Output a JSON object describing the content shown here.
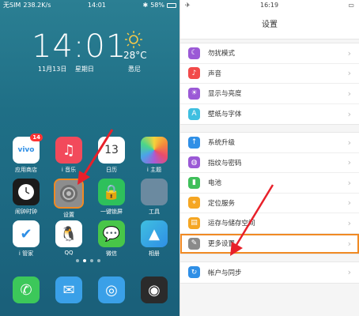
{
  "home": {
    "status": {
      "carrier": "无SIM",
      "speed": "238.2K/s",
      "time": "14:01",
      "battery": "58%"
    },
    "clock": "14:01",
    "date": "11月13日 星期日",
    "temperature": "28°C",
    "city": "悉尼",
    "apps": [
      {
        "label": "应用商店",
        "color": "#ffffff",
        "badge": "14"
      },
      {
        "label": "i 音乐",
        "color": "#f24a5b"
      },
      {
        "label": "日历",
        "color": "#ffffff"
      },
      {
        "label": "i 主题",
        "color": "#ffffff"
      },
      {
        "label": "闹钟时钟",
        "color": "#1b1b1b"
      },
      {
        "label": "设置",
        "color": "#8d8d8d"
      },
      {
        "label": "一键锁屏",
        "color": "#2ec05b"
      },
      {
        "label": "工具",
        "color": "#6b8aa0"
      },
      {
        "label": "i 管家",
        "color": "#ffffff"
      },
      {
        "label": "QQ",
        "color": "#ffffff"
      },
      {
        "label": "微信",
        "color": "#48c648"
      },
      {
        "label": "相册",
        "color": "#ffffff"
      },
      {
        "label": "",
        "color": "#3cc85a"
      },
      {
        "label": "",
        "color": "#3aa0e8"
      },
      {
        "label": "",
        "color": "#3aa0e8"
      },
      {
        "label": "",
        "color": "#2b2b2b"
      }
    ],
    "calendar_date": "13"
  },
  "settings": {
    "status": {
      "time": "16:19"
    },
    "title": "设置",
    "groups": [
      [
        {
          "label": "勿扰模式",
          "icon": "moon-icon",
          "color": "#9b59d6"
        },
        {
          "label": "声音",
          "icon": "sound-icon",
          "color": "#f24a4a"
        },
        {
          "label": "显示与亮度",
          "icon": "brightness-icon",
          "color": "#9b59d6"
        },
        {
          "label": "壁纸与字体",
          "icon": "font-icon",
          "color": "#3fbfe0"
        }
      ],
      [
        {
          "label": "系统升级",
          "icon": "upgrade-icon",
          "color": "#2f8fe6"
        },
        {
          "label": "指纹与密码",
          "icon": "fingerprint-icon",
          "color": "#9b59d6"
        },
        {
          "label": "电池",
          "icon": "battery-icon",
          "color": "#3fbf5a"
        },
        {
          "label": "定位服务",
          "icon": "location-icon",
          "color": "#f5a623"
        },
        {
          "label": "运存与储存空间",
          "icon": "storage-icon",
          "color": "#f5a623"
        },
        {
          "label": "更多设置",
          "icon": "wrench-icon",
          "color": "#8a8a8a"
        }
      ],
      [
        {
          "label": "帐户与同步",
          "icon": "account-icon",
          "color": "#2f8fe6"
        }
      ]
    ]
  }
}
